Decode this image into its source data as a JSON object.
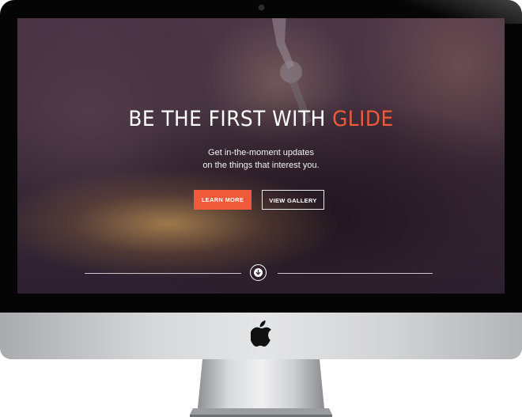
{
  "hero": {
    "title_main": "BE THE FIRST WITH ",
    "title_accent": "GLIDE",
    "subtitle_line1": "Get in-the-moment updates",
    "subtitle_line2": "on the things that interest you."
  },
  "buttons": {
    "learn_more": "LEARN MORE",
    "view_gallery": "VIEW GALLERY"
  },
  "icons": {
    "scroll": "arrow-down-circle-icon",
    "brand": "apple-logo-icon"
  },
  "colors": {
    "accent": "#ee5a3a",
    "text": "#ffffff",
    "bezel": "#050505"
  }
}
